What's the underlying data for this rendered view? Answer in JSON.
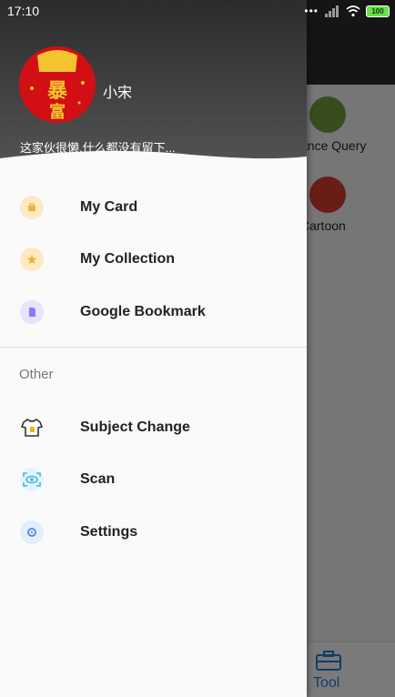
{
  "status_bar": {
    "time": "17:10",
    "battery": "100"
  },
  "background": {
    "tools": [
      {
        "label": "ance Query",
        "color": "#6e9a3c"
      },
      {
        "label": "Cartoon",
        "color": "#d23a2e"
      }
    ],
    "bottom_tab": {
      "label": "Tool"
    }
  },
  "profile": {
    "avatar_text": "暴富",
    "username": "小宋",
    "bio": "这家伙很懒,什么都没有留下..."
  },
  "menu": [
    {
      "label": "My Card",
      "icon": "card-icon"
    },
    {
      "label": "My Collection",
      "icon": "star-icon"
    },
    {
      "label": "Google Bookmark",
      "icon": "bookmark-icon"
    }
  ],
  "other_section": {
    "title": "Other",
    "items": [
      {
        "label": "Subject Change",
        "icon": "tshirt-icon"
      },
      {
        "label": "Scan",
        "icon": "scan-icon"
      },
      {
        "label": "Settings",
        "icon": "gear-icon"
      }
    ]
  }
}
